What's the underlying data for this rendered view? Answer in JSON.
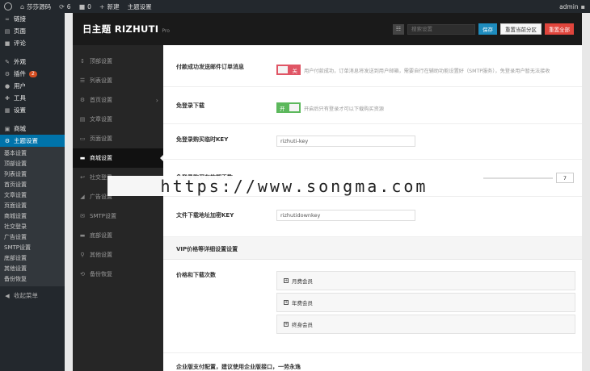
{
  "adminbar": {
    "site_name": "莎莎源码",
    "updates": "6",
    "comments": "0",
    "new_label": "新建",
    "theme_settings": "主题设置",
    "user": "admin"
  },
  "wp_menu": {
    "items": [
      {
        "icon": "link-icon",
        "glyph": "∞",
        "label": "链接"
      },
      {
        "icon": "page-icon",
        "glyph": "▤",
        "label": "页面"
      },
      {
        "icon": "comment-icon",
        "glyph": "■",
        "label": "评论"
      }
    ],
    "items2": [
      {
        "icon": "appearance-icon",
        "glyph": "✎",
        "label": "外观"
      },
      {
        "icon": "plugin-icon",
        "glyph": "⚙",
        "label": "插件",
        "badge": "2"
      },
      {
        "icon": "user-icon",
        "glyph": "●",
        "label": "用户"
      },
      {
        "icon": "tools-icon",
        "glyph": "✚",
        "label": "工具"
      },
      {
        "icon": "settings-icon",
        "glyph": "▦",
        "label": "设置"
      }
    ],
    "shop": {
      "label": "商城"
    },
    "active": {
      "label": "主题设置"
    },
    "submenu": [
      "基本设置",
      "顶部设置",
      "列表设置",
      "首页设置",
      "文章设置",
      "页面设置",
      "商城设置",
      "社交登录",
      "广告设置",
      "SMTP设置",
      "底部设置",
      "其他设置",
      "备份恢复"
    ],
    "collapse": "收起菜单"
  },
  "panel": {
    "title": "日主题 RIZHUTI",
    "version": "Pro",
    "search_placeholder": "搜索设置",
    "save": "保存",
    "reset_section": "重置当前分区",
    "reset_all": "重置全部"
  },
  "nav": [
    {
      "label": "顶部设置",
      "glyph": "↕"
    },
    {
      "label": "列表设置",
      "glyph": "☰"
    },
    {
      "label": "首页设置",
      "glyph": "⚙",
      "arrow": "›"
    },
    {
      "label": "文章设置",
      "glyph": "▤"
    },
    {
      "label": "页面设置",
      "glyph": "▭"
    },
    {
      "label": "商城设置",
      "glyph": "▬",
      "active": true
    },
    {
      "label": "社交登录",
      "glyph": "↩"
    },
    {
      "label": "广告设置",
      "glyph": "◢"
    },
    {
      "label": "SMTP设置",
      "glyph": "✉"
    },
    {
      "label": "底部设置",
      "glyph": "▬"
    },
    {
      "label": "其他设置",
      "glyph": "⚲"
    },
    {
      "label": "备份恢复",
      "glyph": "⟲"
    }
  ],
  "form": {
    "pay_email": {
      "label": "付款成功发送邮件订单消息",
      "toggle": "关",
      "help": "用户付款成功，订单消息将发送到用户邮箱，需要自行在辅助功能设置好（SMTP服务），免登录用户暂无法接收"
    },
    "free_login": {
      "label": "免登录下载",
      "toggle": "开",
      "help": "开启后只有登录才可以下载购买资源"
    },
    "free_key": {
      "label": "免登录购买临时KEY",
      "value": "rizhuti-key"
    },
    "valid_days": {
      "label": "免登录购买有效期天数",
      "value": "7"
    },
    "download_key": {
      "label": "文件下载地址加密KEY",
      "value": "rizhutidownkey"
    },
    "vip_section": {
      "label": "VIP价格等详细设置设置"
    },
    "price_label": "价格和下载次数",
    "vip_tiers": [
      "月费会员",
      "年费会员",
      "终身会员"
    ],
    "enterprise": {
      "label": "企业版支付配置，建议使用企业版接口，一劳永逸"
    }
  },
  "watermark": "https://www.songma.com"
}
